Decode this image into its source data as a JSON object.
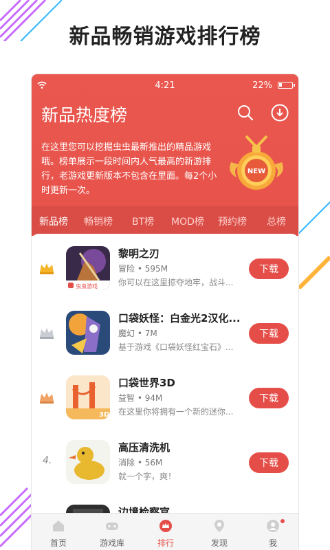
{
  "promo": {
    "title": "新品畅销游戏排行榜"
  },
  "status": {
    "time": "4:21",
    "battery": "22%"
  },
  "header": {
    "title": "新品热度榜",
    "description": "在这里您可以挖掘虫虫最新推出的精品游戏哦。榜单展示一段时间内人气最高的新游排行，老游戏更新版本不包含在里面。每2个小时更新一次。",
    "medal_text": "NEW"
  },
  "tabs": [
    {
      "label": "新品榜",
      "active": true
    },
    {
      "label": "畅销榜",
      "active": false
    },
    {
      "label": "BT榜",
      "active": false
    },
    {
      "label": "MOD榜",
      "active": false
    },
    {
      "label": "预约榜",
      "active": false
    },
    {
      "label": "总榜",
      "active": false
    }
  ],
  "apps": [
    {
      "rank": "1",
      "rank_icon": "gold-crown-icon",
      "name": "黎明之刃",
      "meta": "冒险 • 595M",
      "desc": "你可以在这里掠夺地牢，战斗...",
      "button": "下载",
      "icon_badge": "虫虫游戏"
    },
    {
      "rank": "2",
      "rank_icon": "silver-crown-icon",
      "name": "口袋妖怪：白金光2汉化...",
      "meta": "魔幻 • 7M",
      "desc": "基于游戏《口袋妖怪红宝石》...",
      "button": "下载"
    },
    {
      "rank": "3",
      "rank_icon": "bronze-crown-icon",
      "name": "口袋世界3D",
      "meta": "益智 • 94M",
      "desc": "在这里你将拥有一个新的迷你...",
      "button": "下载",
      "icon_badge": "3D"
    },
    {
      "rank": "4.",
      "name": "高压清洗机",
      "meta": "消除 • 56M",
      "desc": "就一个字，爽！",
      "button": "下载"
    },
    {
      "rank": "",
      "name": "边境检察官",
      "meta": "",
      "desc": "",
      "button": ""
    }
  ],
  "nav": [
    {
      "label": "首页",
      "icon": "home-icon",
      "active": false
    },
    {
      "label": "游戏库",
      "icon": "gamepad-icon",
      "active": false
    },
    {
      "label": "排行",
      "icon": "ranking-icon",
      "active": true
    },
    {
      "label": "发现",
      "icon": "discover-icon",
      "active": false
    },
    {
      "label": "我",
      "icon": "profile-icon",
      "active": false,
      "dot": true
    }
  ],
  "colors": {
    "accent": "#e54e48",
    "hero": "#e9574f"
  }
}
